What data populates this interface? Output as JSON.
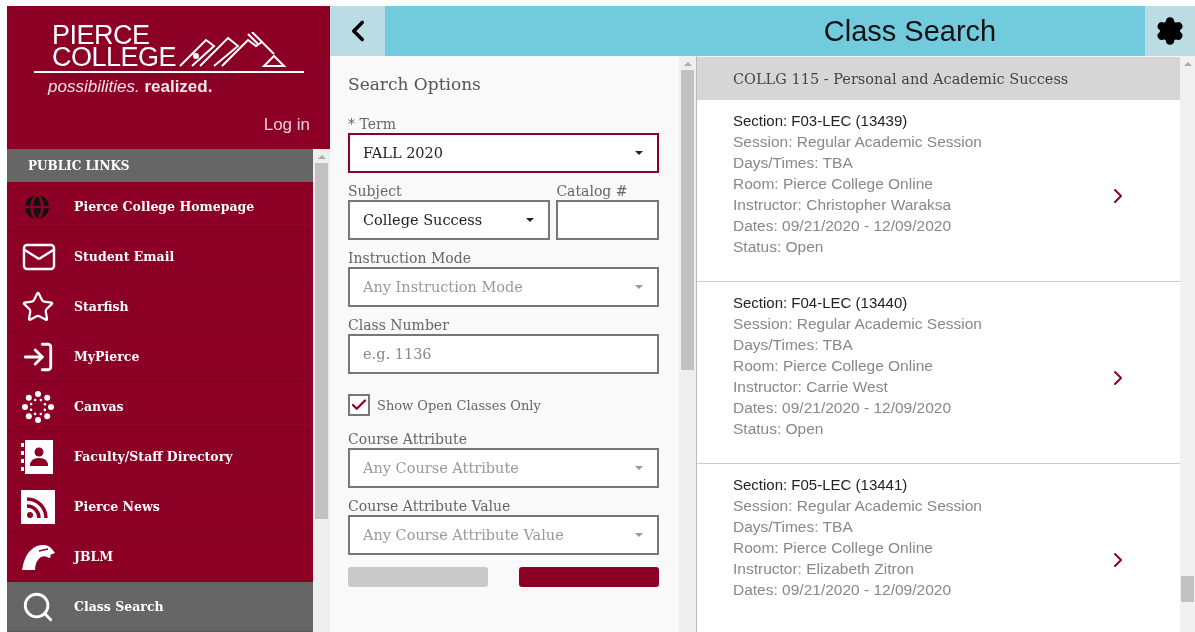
{
  "logo": {
    "name_line1": "PIERCE",
    "name_line2": "COLLEGE",
    "tagline": "*possibilities.* **realized.**"
  },
  "login": "Log in",
  "sidebar": {
    "heading": "PUBLIC LINKS",
    "items": [
      {
        "label": "Pierce College Homepage",
        "selected": false
      },
      {
        "label": "Student Email",
        "selected": false
      },
      {
        "label": "Starfish",
        "selected": false
      },
      {
        "label": "MyPierce",
        "selected": false
      },
      {
        "label": "Canvas",
        "selected": false
      },
      {
        "label": "Faculty/Staff Directory",
        "selected": false
      },
      {
        "label": "Pierce News",
        "selected": false
      },
      {
        "label": "JBLM",
        "selected": false
      },
      {
        "label": "Class Search",
        "selected": true
      }
    ]
  },
  "header": {
    "title": "Class Search"
  },
  "search_options": {
    "title": "Search Options",
    "fields": [
      {
        "kind": "select",
        "label": "* Term",
        "value": "FALL 2020",
        "focused": true
      },
      {
        "kind": "pair",
        "label": "Subject",
        "value": "College Success",
        "second_label": "Catalog #",
        "focused": false
      },
      {
        "kind": "select",
        "label": "Instruction Mode",
        "placeholder": "Any Instruction Mode",
        "focused": false
      },
      {
        "kind": "input",
        "label": "Class Number",
        "placeholder": "e.g. 1136",
        "focused": false
      },
      {
        "kind": "checkbox",
        "label": "Show Open Classes Only",
        "checked": true
      },
      {
        "kind": "select",
        "label": "Course Attribute",
        "placeholder": "Any Course Attribute",
        "focused": false
      },
      {
        "kind": "select",
        "label": "Course Attribute Value",
        "placeholder": "Any Course Attribute Value",
        "focused": false
      }
    ]
  },
  "results": {
    "course": "COLLG 115 - Personal and Academic Success",
    "sections": [
      {
        "title": "Section: F03-LEC (13439)",
        "lines": [
          "Session: Regular Academic Session",
          "Days/Times: TBA",
          "Room: Pierce College Online",
          "Instructor: Christopher Waraksa",
          "Dates: 09/21/2020 - 12/09/2020",
          "Status: Open"
        ]
      },
      {
        "title": "Section: F04-LEC (13440)",
        "lines": [
          "Session: Regular Academic Session",
          "Days/Times: TBA",
          "Room: Pierce College Online",
          "Instructor: Carrie West",
          "Dates: 09/21/2020 - 12/09/2020",
          "Status: Open"
        ]
      },
      {
        "title": "Section: F05-LEC (13441)",
        "lines": [
          "Session: Regular Academic Session",
          "Days/Times: TBA",
          "Room: Pierce College Online",
          "Instructor: Elizabeth Zitron",
          "Dates: 09/21/2020 - 12/09/2020"
        ]
      }
    ]
  }
}
